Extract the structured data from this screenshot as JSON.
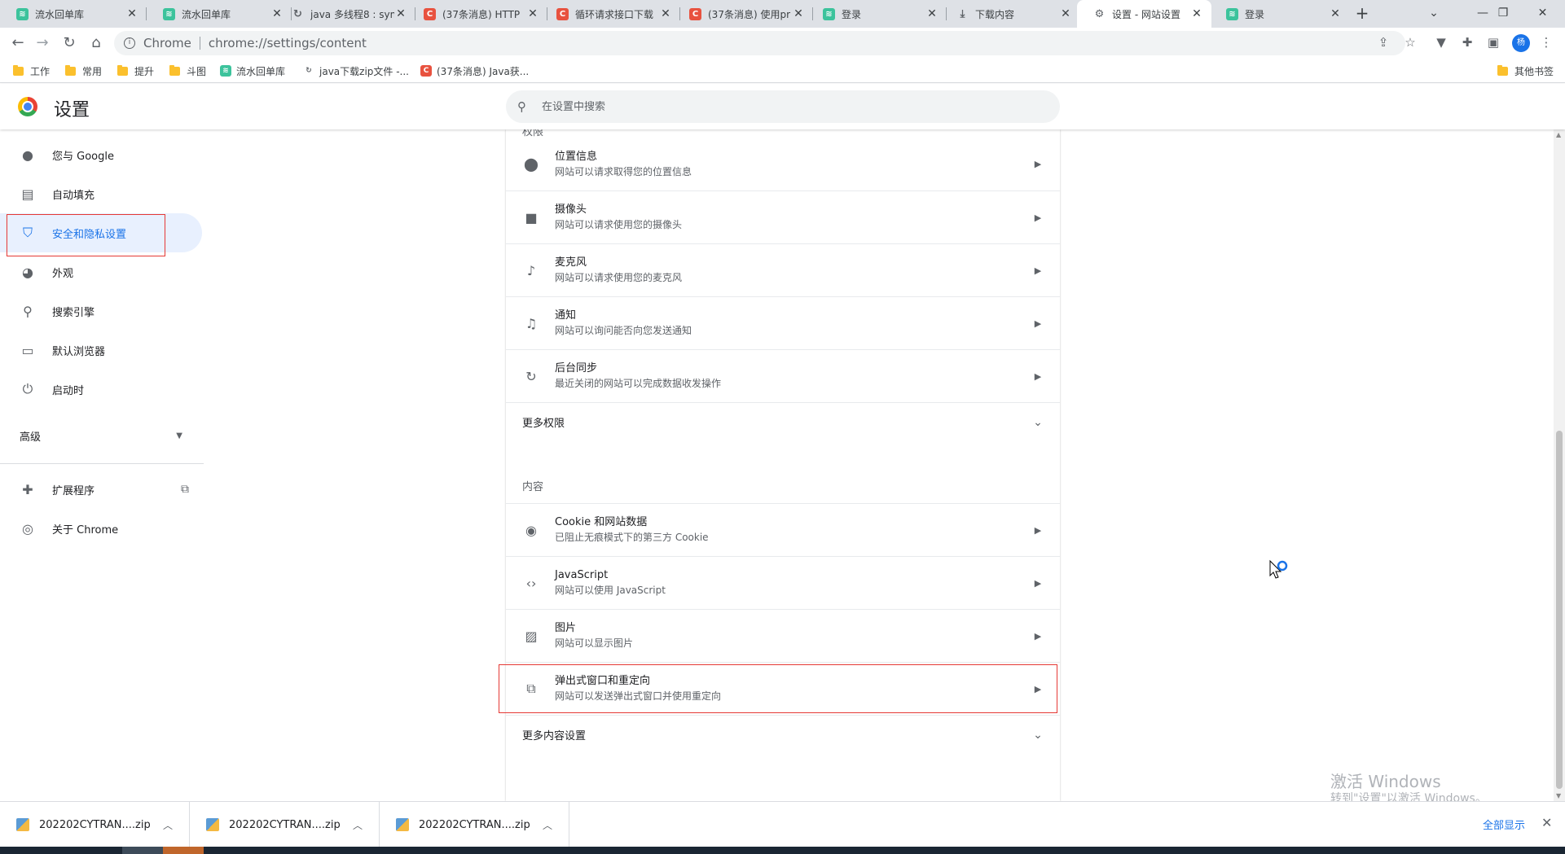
{
  "tabs": [
    {
      "title": "流水回单库",
      "favicon": "green"
    },
    {
      "title": "流水回单库",
      "favicon": "green"
    },
    {
      "title": "java 多线程8 : sym",
      "favicon": "gray"
    },
    {
      "title": "(37条消息) HTTP",
      "favicon": "red"
    },
    {
      "title": "循环请求接口下载",
      "favicon": "red"
    },
    {
      "title": "(37条消息) 使用pr",
      "favicon": "red"
    },
    {
      "title": "登录",
      "favicon": "green"
    },
    {
      "title": "下载内容",
      "favicon": "download"
    },
    {
      "title": "设置 - 网站设置",
      "favicon": "gear",
      "active": true
    },
    {
      "title": "登录",
      "favicon": "green"
    }
  ],
  "toolbar": {
    "scheme": "Chrome",
    "url": "chrome://settings/content",
    "avatar": "杨"
  },
  "bookmarks": [
    {
      "label": "工作",
      "type": "folder"
    },
    {
      "label": "常用",
      "type": "folder"
    },
    {
      "label": "提升",
      "type": "folder"
    },
    {
      "label": "斗图",
      "type": "folder"
    },
    {
      "label": "流水回单库",
      "type": "green"
    },
    {
      "label": "java下载zip文件 -...",
      "type": "gray"
    },
    {
      "label": "(37条消息) Java获...",
      "type": "red"
    }
  ],
  "bookmarks_other": "其他书签",
  "header": {
    "title": "设置",
    "search_placeholder": "在设置中搜索"
  },
  "sidebar": {
    "items": [
      {
        "label": "您与 Google",
        "icon": "person-icon"
      },
      {
        "label": "自动填充",
        "icon": "clipboard-icon"
      },
      {
        "label": "安全和隐私设置",
        "icon": "shield-icon",
        "active": true
      },
      {
        "label": "外观",
        "icon": "palette-icon"
      },
      {
        "label": "搜索引擎",
        "icon": "search-icon"
      },
      {
        "label": "默认浏览器",
        "icon": "browser-icon"
      },
      {
        "label": "启动时",
        "icon": "power-icon"
      }
    ],
    "advanced": "高级",
    "extensions": "扩展程序",
    "about": "关于 Chrome"
  },
  "content": {
    "partial_section": "权限",
    "permissions": [
      {
        "title": "位置信息",
        "subtitle": "网站可以请求取得您的位置信息",
        "icon": "location-icon"
      },
      {
        "title": "摄像头",
        "subtitle": "网站可以请求使用您的摄像头",
        "icon": "camera-icon"
      },
      {
        "title": "麦克风",
        "subtitle": "网站可以请求使用您的麦克风",
        "icon": "mic-icon"
      },
      {
        "title": "通知",
        "subtitle": "网站可以询问能否向您发送通知",
        "icon": "bell-icon"
      },
      {
        "title": "后台同步",
        "subtitle": "最近关闭的网站可以完成数据收发操作",
        "icon": "sync-icon"
      }
    ],
    "more_permissions": "更多权限",
    "content_section": "内容",
    "content_items": [
      {
        "title": "Cookie 和网站数据",
        "subtitle": "已阻止无痕模式下的第三方 Cookie",
        "icon": "cookie-icon"
      },
      {
        "title": "JavaScript",
        "subtitle": "网站可以使用 JavaScript",
        "icon": "code-icon"
      },
      {
        "title": "图片",
        "subtitle": "网站可以显示图片",
        "icon": "image-icon"
      },
      {
        "title": "弹出式窗口和重定向",
        "subtitle": "网站可以发送弹出式窗口并使用重定向",
        "icon": "open-in-new-icon",
        "highlighted": true
      }
    ],
    "more_content": "更多内容设置"
  },
  "watermark": {
    "line1": "激活 Windows",
    "line2": "转到\"设置\"以激活 Windows。"
  },
  "downloads": {
    "items": [
      "202202CYTRAN....zip",
      "202202CYTRAN....zip",
      "202202CYTRAN....zip"
    ],
    "show_all": "全部显示"
  },
  "colors": {
    "accent": "#1a73e8",
    "highlight_border": "#e53935",
    "active_nav_bg": "#e8f0fe"
  }
}
